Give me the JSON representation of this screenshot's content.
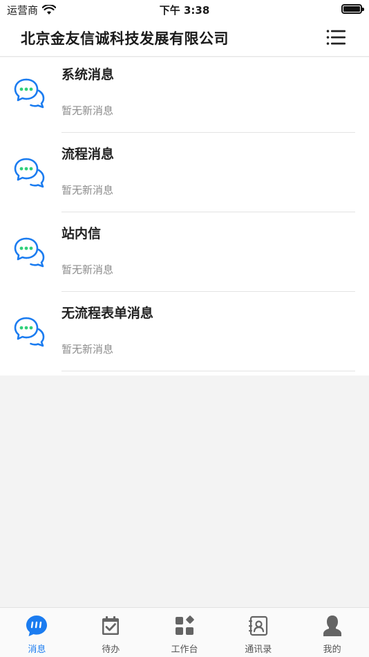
{
  "status_bar": {
    "carrier": "运营商",
    "time": "下午 3:38"
  },
  "header": {
    "title": "北京金友信诚科技发展有限公司"
  },
  "messages": [
    {
      "title": "系统消息",
      "subtitle": "暂无新消息"
    },
    {
      "title": "流程消息",
      "subtitle": "暂无新消息"
    },
    {
      "title": "站内信",
      "subtitle": "暂无新消息"
    },
    {
      "title": "无流程表单消息",
      "subtitle": "暂无新消息"
    }
  ],
  "tabs": [
    {
      "label": "消息",
      "icon": "chat-bubble-icon",
      "active": true
    },
    {
      "label": "待办",
      "icon": "calendar-check-icon",
      "active": false
    },
    {
      "label": "工作台",
      "icon": "grid-apps-icon",
      "active": false
    },
    {
      "label": "通讯录",
      "icon": "contacts-book-icon",
      "active": false
    },
    {
      "label": "我的",
      "icon": "person-icon",
      "active": false
    }
  ],
  "colors": {
    "accent": "#1b7cf0",
    "dots": "#2fd07a",
    "icon_blue": "#1b7cf0"
  }
}
